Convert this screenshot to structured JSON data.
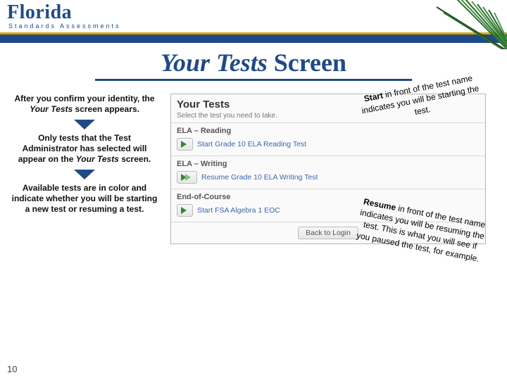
{
  "header": {
    "brand_line1": "Florida",
    "brand_line2": "Standards Assessments"
  },
  "title": {
    "italic": "Your Tests",
    "rest": " Screen"
  },
  "notes": [
    {
      "pre": "After you confirm your identity, the ",
      "ital": "Your Tests",
      "post": " screen appears."
    },
    {
      "pre": "Only tests that the Test Administrator has selected will appear on the ",
      "ital": "Your Tests",
      "post": " screen."
    },
    {
      "pre": "Available tests are in color and indicate whether you will be starting a new test or resuming a test.",
      "ital": "",
      "post": ""
    }
  ],
  "screenshot": {
    "title": "Your Tests",
    "subtitle": "Select the test you need to take.",
    "sections": [
      {
        "header": "ELA – Reading",
        "btn_type": "start",
        "label": "Start Grade 10 ELA Reading Test"
      },
      {
        "header": "ELA – Writing",
        "btn_type": "resume",
        "label": "Resume Grade 10 ELA Writing Test"
      },
      {
        "header": "End-of-Course",
        "btn_type": "start",
        "label": "Start FSA Algebra 1 EOC"
      }
    ],
    "back": "Back to Login"
  },
  "callouts": {
    "start": {
      "kw": "Start",
      "rest": " in front of the test name indicates you will be starting the test."
    },
    "resume": {
      "kw": "Resume",
      "rest": " in front of the test name indicates you will be resuming the test. This is what you will see if you paused the test, for example."
    }
  },
  "page_number": "10"
}
